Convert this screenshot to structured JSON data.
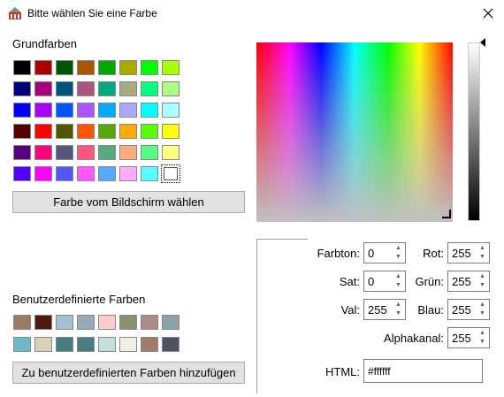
{
  "window": {
    "title": "Bitte wählen Sie eine Farbe"
  },
  "basic_colors": {
    "label": "Grundfarben",
    "colors": [
      "#000000",
      "#aa0000",
      "#005500",
      "#aa5500",
      "#00aa00",
      "#aaaa00",
      "#00ff00",
      "#aaff00",
      "#00007f",
      "#aa007f",
      "#00557f",
      "#aa557f",
      "#00aa7f",
      "#aaaa7f",
      "#00ff7f",
      "#aaff7f",
      "#0000ff",
      "#aa00ff",
      "#0055ff",
      "#aa55ff",
      "#00aaff",
      "#aaaaff",
      "#00ffff",
      "#aaffff",
      "#550000",
      "#ff0000",
      "#555500",
      "#ff5500",
      "#55aa00",
      "#ffaa00",
      "#55ff00",
      "#ffff00",
      "#55007f",
      "#ff007f",
      "#55557f",
      "#ff557f",
      "#55aa7f",
      "#ffaa7f",
      "#55ff7f",
      "#ffff7f",
      "#5500ff",
      "#ff00ff",
      "#5555ff",
      "#ff55ff",
      "#55aaff",
      "#ffaaff",
      "#55ffff",
      "#ffffff"
    ],
    "selected_index": 47
  },
  "pick_screen_button": "Farbe vom Bildschirm wählen",
  "custom_colors": {
    "label": "Benutzerdefinierte Farben",
    "colors": [
      "#9c7a63",
      "#4d1a0d",
      "#a4c1d3",
      "#98aab8",
      "#ffcccc",
      "#8a8f6e",
      "#ad8c8c",
      "#89a3a8",
      "#6fbac6",
      "#d9d0b9",
      "#447c80",
      "#4a7e82",
      "#c5e0dc",
      "#f0efe6",
      "#9f7d66",
      "#4a5560"
    ]
  },
  "add_custom_button": "Zu benutzerdefinierten Farben hinzufügen",
  "fields": {
    "hue": {
      "label": "Farbton:",
      "value": "0"
    },
    "sat": {
      "label": "Sat:",
      "value": "0"
    },
    "val": {
      "label": "Val:",
      "value": "255"
    },
    "red": {
      "label": "Rot:",
      "value": "255"
    },
    "green": {
      "label": "Grün:",
      "value": "255"
    },
    "blue": {
      "label": "Blau:",
      "value": "255"
    },
    "alpha": {
      "label": "Alphakanal:",
      "value": "255"
    },
    "html": {
      "label": "HTML:",
      "value": "#ffffff"
    }
  },
  "current_color": "#ffffff",
  "icons": {
    "app": "app-window-icon",
    "close": "close-icon"
  }
}
